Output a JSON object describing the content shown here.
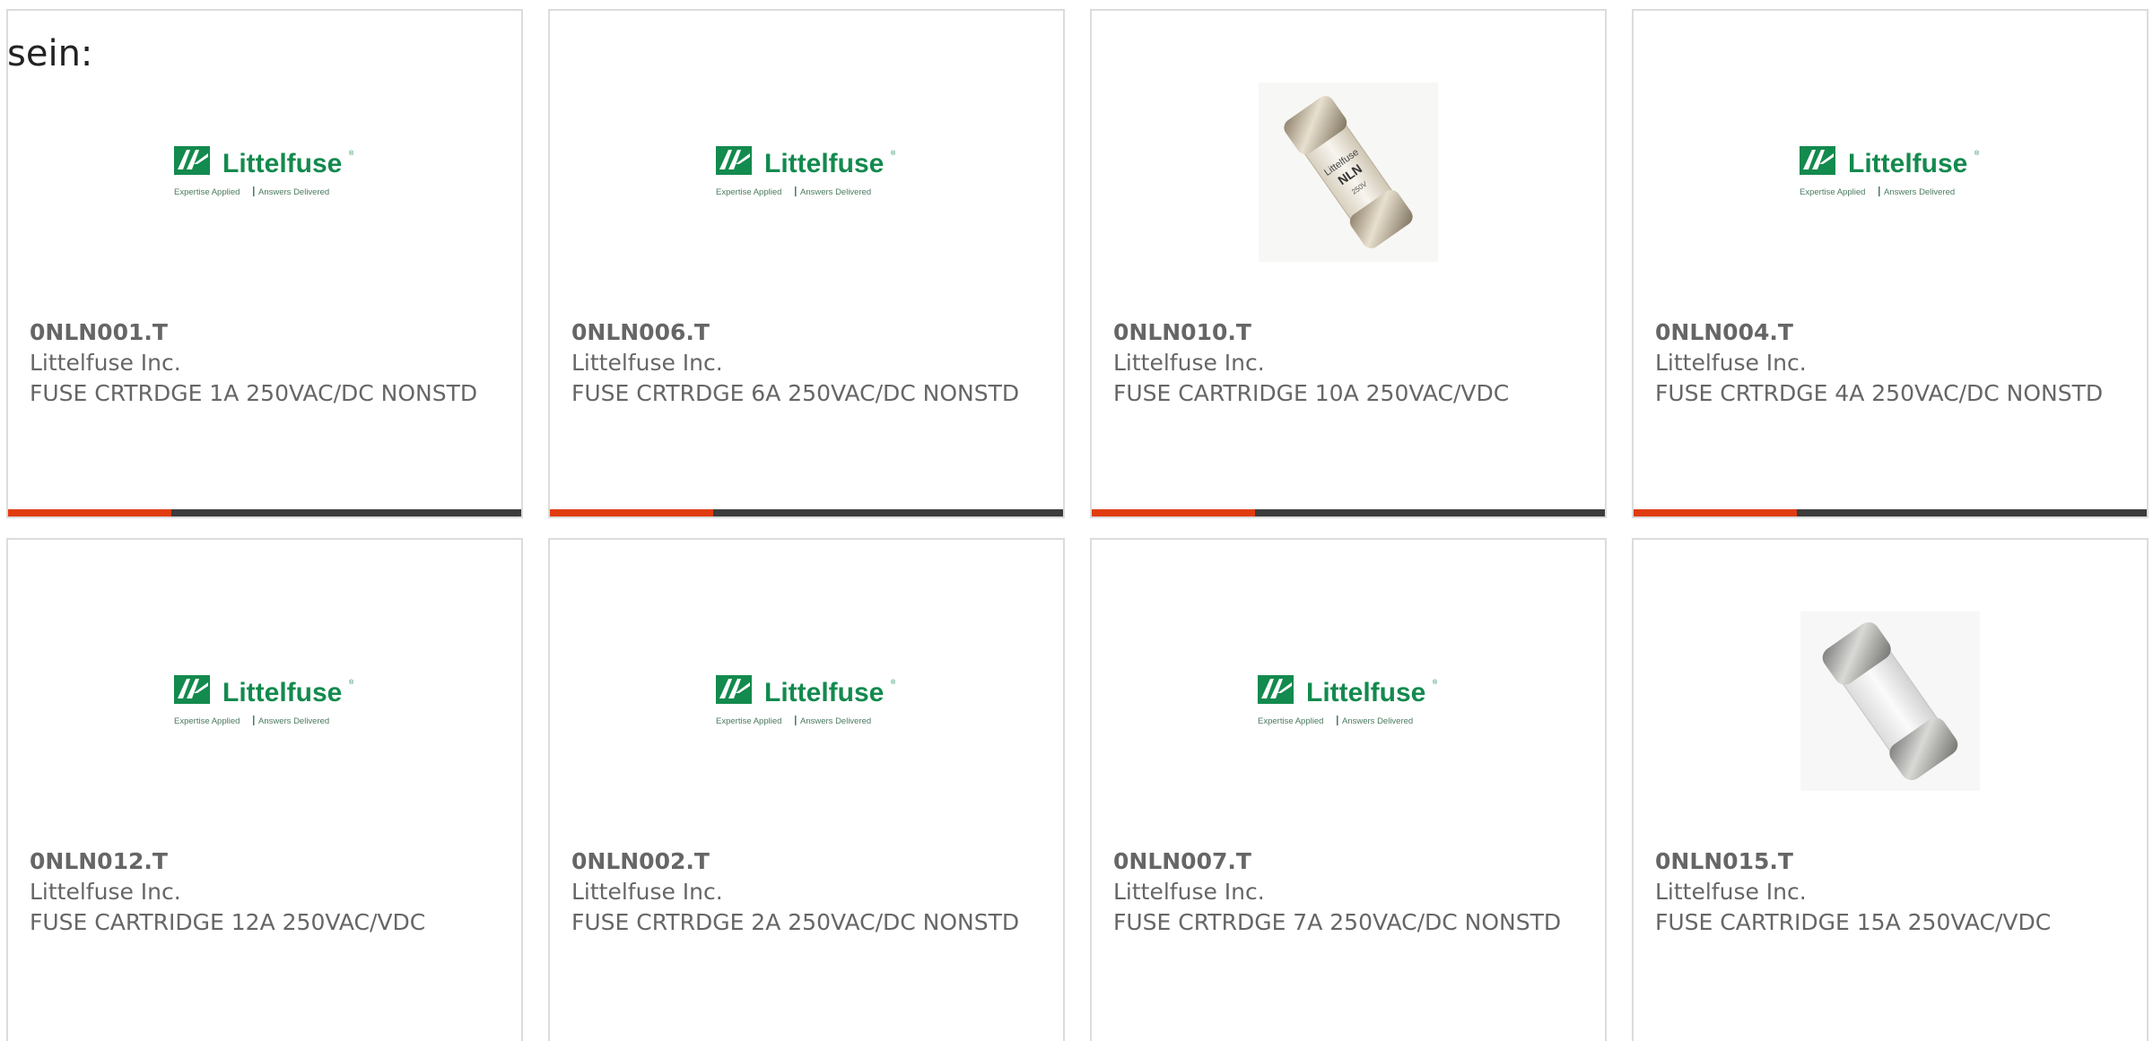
{
  "intro_text": "sein:",
  "colors": {
    "accent": "#e03c10",
    "bar": "#3c3c3c",
    "border": "#dcdcdc",
    "text": "#666666",
    "brand_green": "#138a4e"
  },
  "logo": {
    "name": "Littelfuse",
    "tagline": "Expertise Applied | Answers Delivered",
    "icon": "littelfuse-logo"
  },
  "products": [
    {
      "part_number": "0NLN001.T",
      "manufacturer": "Littelfuse Inc.",
      "description": "FUSE CRTRDGE 1A 250VAC/DC NONSTD",
      "image": "littelfuse-logo"
    },
    {
      "part_number": "0NLN006.T",
      "manufacturer": "Littelfuse Inc.",
      "description": "FUSE CRTRDGE 6A 250VAC/DC NONSTD",
      "image": "littelfuse-logo"
    },
    {
      "part_number": "0NLN010.T",
      "manufacturer": "Littelfuse Inc.",
      "description": "FUSE CARTRIDGE 10A 250VAC/VDC",
      "image": "fuse-photo-labeled"
    },
    {
      "part_number": "0NLN004.T",
      "manufacturer": "Littelfuse Inc.",
      "description": "FUSE CRTRDGE 4A 250VAC/DC NONSTD",
      "image": "littelfuse-logo"
    },
    {
      "part_number": "0NLN012.T",
      "manufacturer": "Littelfuse Inc.",
      "description": "FUSE CARTRIDGE 12A 250VAC/VDC",
      "image": "littelfuse-logo"
    },
    {
      "part_number": "0NLN002.T",
      "manufacturer": "Littelfuse Inc.",
      "description": "FUSE CRTRDGE 2A 250VAC/DC NONSTD",
      "image": "littelfuse-logo"
    },
    {
      "part_number": "0NLN007.T",
      "manufacturer": "Littelfuse Inc.",
      "description": "FUSE CRTRDGE 7A 250VAC/DC NONSTD",
      "image": "littelfuse-logo"
    },
    {
      "part_number": "0NLN015.T",
      "manufacturer": "Littelfuse Inc.",
      "description": "FUSE CARTRIDGE 15A 250VAC/VDC",
      "image": "fuse-photo-white"
    }
  ]
}
